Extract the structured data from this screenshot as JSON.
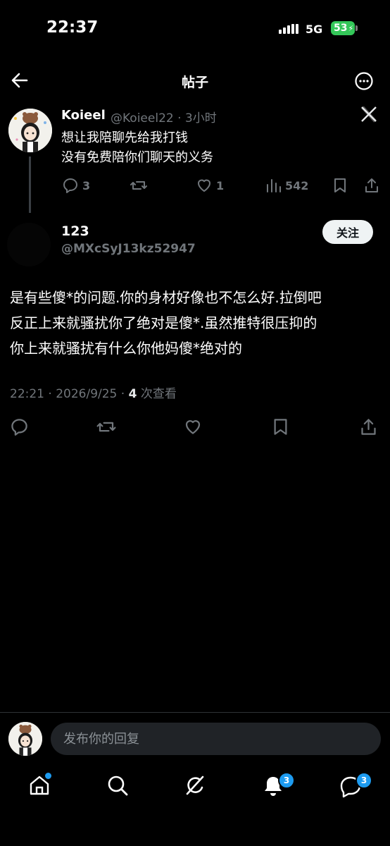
{
  "status_bar": {
    "time": "22:37",
    "network": "5G",
    "battery": "53"
  },
  "header": {
    "title": "帖子"
  },
  "parent_tweet": {
    "name": "Koieel",
    "handle_time": "@Koieel22 · 3小时",
    "lines": [
      "想让我陪聊先给我打钱",
      "没有免费陪你们聊天的义务"
    ],
    "replies": "3",
    "likes": "1",
    "views": "542"
  },
  "post": {
    "author_name": "123",
    "author_handle": "@MXcSyJ13kz52947",
    "follow_label": "关注",
    "lines": [
      "是有些傻*的问题.你的身材好像也不怎么好.拉倒吧",
      "反正上来就骚扰你了绝对是傻*.虽然推特很压抑的",
      "你上来就骚扰有什么你他妈傻*绝对的"
    ],
    "timestamp": "22:21 · 2026/9/25 · ",
    "views_count": "4",
    "views_label": " 次查看"
  },
  "reply_bar": {
    "placeholder": "发布你的回复"
  },
  "bottom_nav": {
    "notifications_badge": "3",
    "messages_badge": "3"
  },
  "colors": {
    "accent": "#1d9bf0",
    "background": "#000000",
    "muted": "#71767b"
  }
}
